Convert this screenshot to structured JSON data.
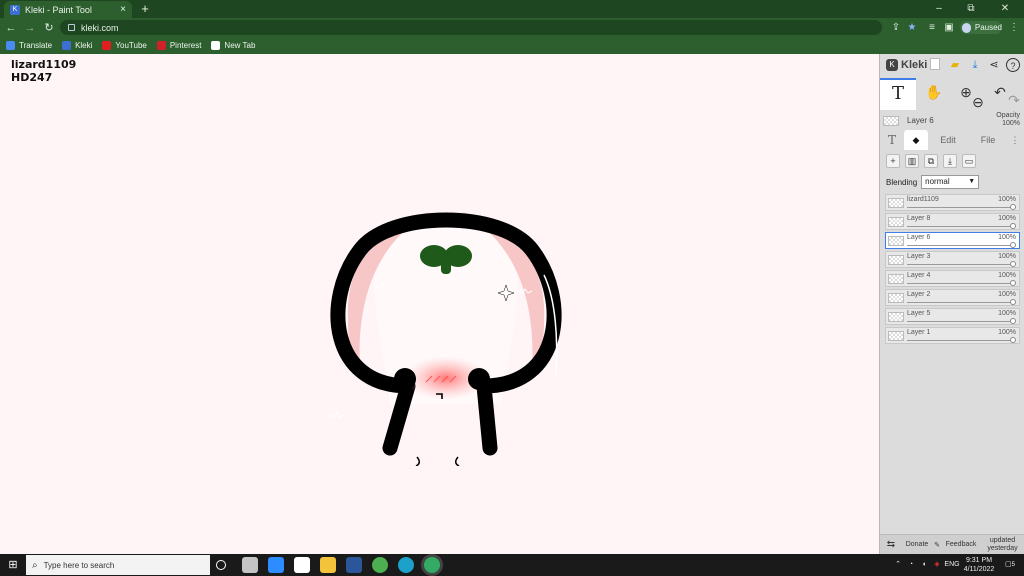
{
  "browser": {
    "tab_title": "Kleki - Paint Tool",
    "tab_close": "×",
    "new_tab": "+",
    "url": "kleki.com",
    "profile_status": "Paused",
    "window_controls": [
      "–",
      "⧉",
      "✕"
    ],
    "bookmarks": [
      {
        "label": "Translate",
        "color": "#4a8af4"
      },
      {
        "label": "Kleki",
        "color": "#3b6fd1"
      },
      {
        "label": "YouTube",
        "color": "#e02020"
      },
      {
        "label": "Pinterest",
        "color": "#d0202a"
      },
      {
        "label": "New Tab",
        "color": "#ffffff"
      }
    ]
  },
  "canvas": {
    "signature_line1": "lizard1109",
    "signature_line2": "HD247",
    "background": "#fff5f6"
  },
  "panel": {
    "brand": "Kleki",
    "current_layer": "Layer 6",
    "opacity_label": "Opacity",
    "opacity_value": "100%",
    "tabs": [
      "Edit",
      "File"
    ],
    "blending_label": "Blending",
    "blending_value": "normal",
    "layers": [
      {
        "name": "lizard1109",
        "opacity": "100%"
      },
      {
        "name": "Layer 8",
        "opacity": "100%"
      },
      {
        "name": "Layer 6",
        "opacity": "100%"
      },
      {
        "name": "Layer 3",
        "opacity": "100%"
      },
      {
        "name": "Layer 4",
        "opacity": "100%"
      },
      {
        "name": "Layer 2",
        "opacity": "100%"
      },
      {
        "name": "Layer 5",
        "opacity": "100%"
      },
      {
        "name": "Layer 1",
        "opacity": "100%"
      }
    ],
    "footer": {
      "donate": "Donate",
      "feedback": "Feedback",
      "updated_line1": "updated",
      "updated_line2": "yesterday"
    },
    "accent": "#3f7ee8"
  },
  "taskbar": {
    "search_placeholder": "Type here to search",
    "language": "ENG",
    "time": "9:31 PM",
    "date": "4/11/2022",
    "notification_count": "5"
  }
}
